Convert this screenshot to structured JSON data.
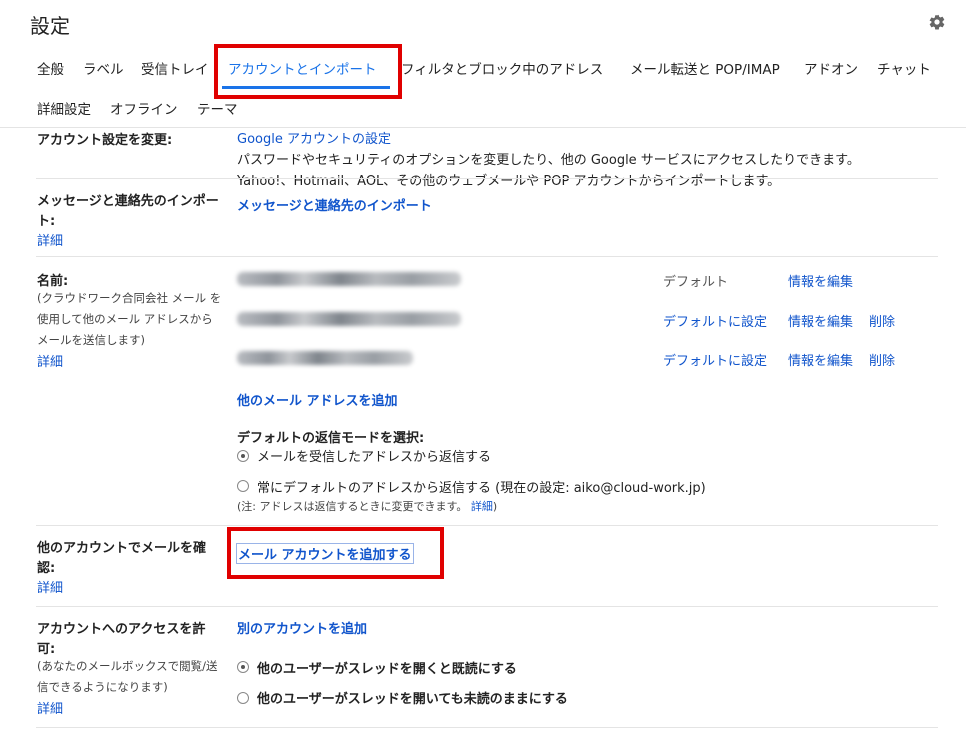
{
  "header": {
    "title": "設定"
  },
  "tabs_row1": [
    "全般",
    "ラベル",
    "受信トレイ",
    "アカウントとインポート",
    "フィルタとブロック中のアドレス",
    "メール転送と POP/IMAP",
    "アドオン",
    "チャット"
  ],
  "tabs_row2": [
    "詳細設定",
    "オフライン",
    "テーマ"
  ],
  "account_settings": {
    "label": "アカウント設定を変更:",
    "link": "Google アカウントの設定",
    "desc": "パスワードやセキュリティのオプションを変更したり、他の Google サービスにアクセスしたりできます。"
  },
  "import": {
    "label_line1": "メッセージと連絡先のインポー",
    "label_line2": "ト:",
    "detail": "詳細",
    "desc": "Yahoo!、Hotmail、AOL、その他のウェブメールや POP アカウントからインポートします。",
    "link": "メッセージと連絡先のインポート"
  },
  "send_as": {
    "label": "名前:",
    "sub_line1": "(クラウドワーク合同会社 メール を",
    "sub_line2": "使用して他のメール アドレスから",
    "sub_line3": "メールを送信します)",
    "detail": "詳細",
    "rows": [
      {
        "status": "デフォルト",
        "edit": "情報を編集",
        "delete": ""
      },
      {
        "status": "デフォルトに設定",
        "edit": "情報を編集",
        "delete": "削除"
      },
      {
        "status": "デフォルトに設定",
        "edit": "情報を編集",
        "delete": "削除"
      }
    ],
    "add_link": "他のメール アドレスを追加",
    "reply_label": "デフォルトの返信モードを選択:",
    "reply_opt1": "メールを受信したアドレスから返信する",
    "reply_opt2": "常にデフォルトのアドレスから返信する (現在の設定: aiko@cloud-work.jp)",
    "note": "(注: アドレスは返信するときに変更できます。",
    "note_link": "詳細",
    "note_end": ")"
  },
  "check_mail": {
    "label_line1": "他のアカウントでメールを確",
    "label_line2": "認:",
    "detail": "詳細",
    "link": "メール アカウントを追加する"
  },
  "grant_access": {
    "label_line1": "アカウントへのアクセスを許",
    "label_line2": "可:",
    "sub_line1": "(あなたのメールボックスで閲覧/送",
    "sub_line2": "信できるようになります)",
    "detail": "詳細",
    "link": "別のアカウントを追加",
    "opt1": "他のユーザーがスレッドを開くと既読にする",
    "opt2": "他のユーザーがスレッドを開いても未読のままにする"
  },
  "colors": {
    "link": "#1155cc",
    "tab_active": "#1a73e8",
    "highlight": "#e00000"
  }
}
